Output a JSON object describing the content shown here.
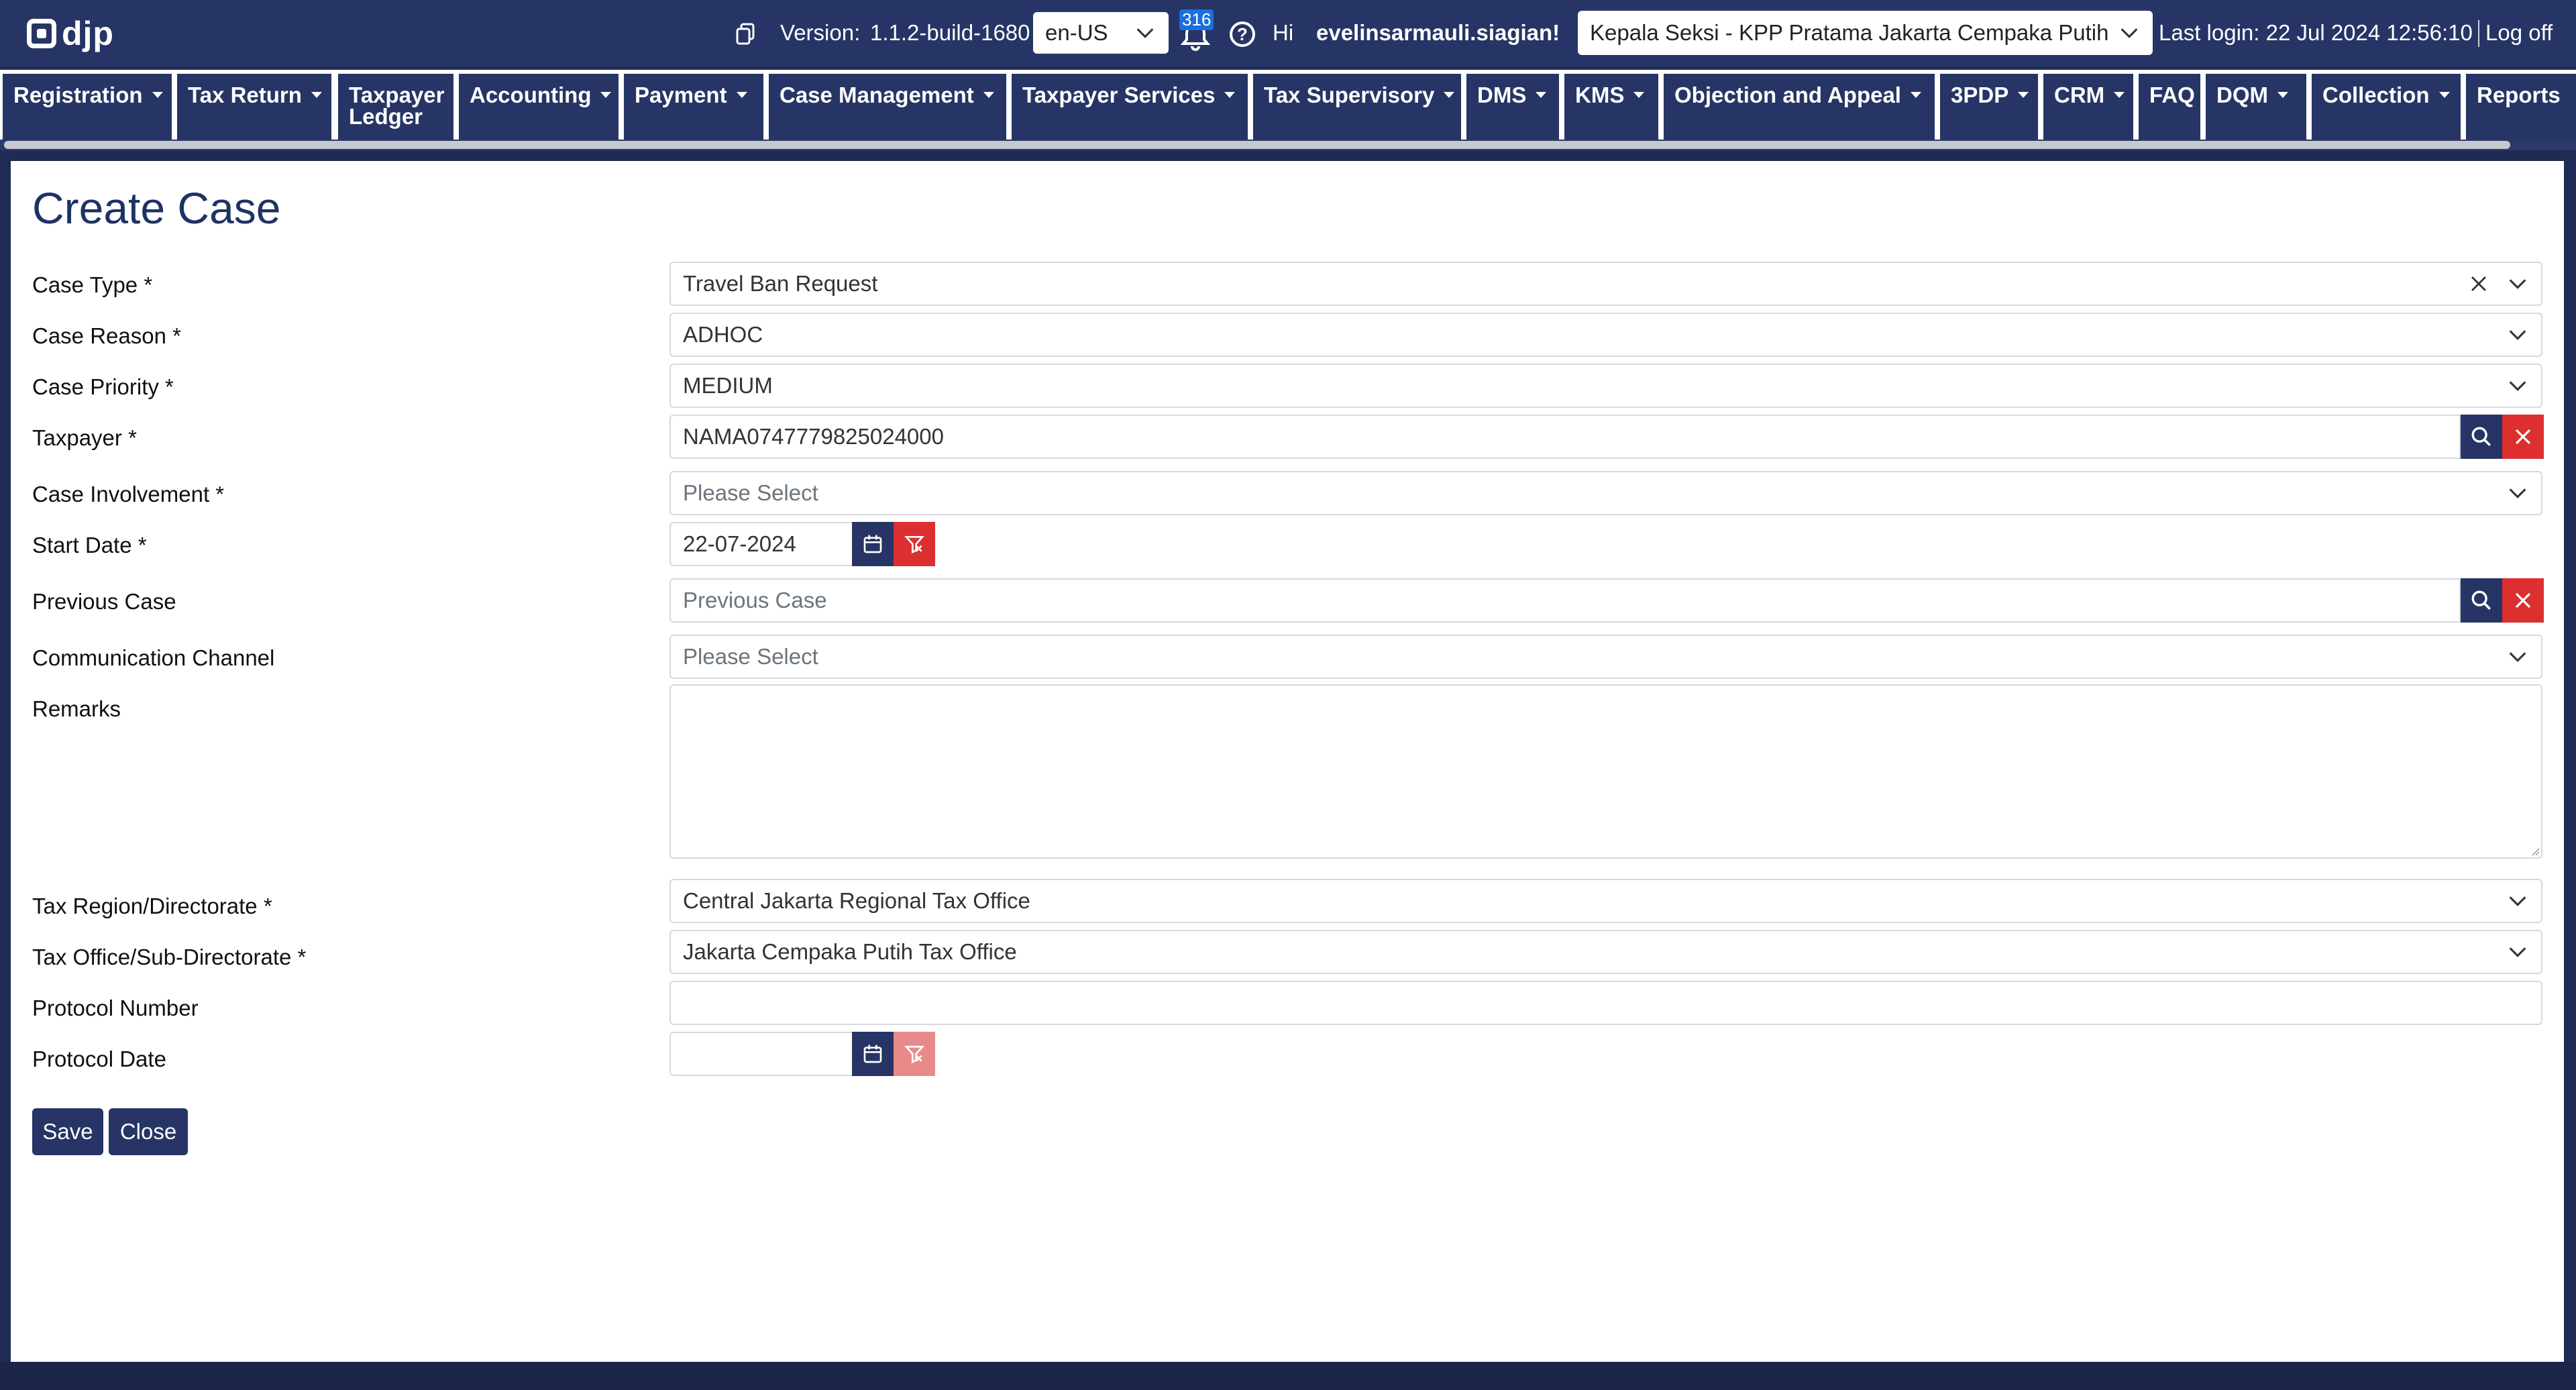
{
  "header": {
    "logo_text": "djp",
    "version_label": "Version:",
    "version_value": "1.1.2-build-1680",
    "language": "en-US",
    "notification_count": "316",
    "greeting": "Hi",
    "username": "evelinsarmauli.siagian!",
    "role": "Kepala Seksi - KPP Pratama Jakarta Cempaka Putih",
    "last_login": "Last login: 22 Jul 2024 12:56:10",
    "logoff": "Log off"
  },
  "nav": {
    "items": [
      {
        "label": "Registration"
      },
      {
        "label": "Tax Return"
      },
      {
        "label": "Taxpayer",
        "label2": "Ledger"
      },
      {
        "label": "Accounting"
      },
      {
        "label": "Payment"
      },
      {
        "label": "Case Management"
      },
      {
        "label": "Taxpayer Services"
      },
      {
        "label": "Tax Supervisory"
      },
      {
        "label": "DMS"
      },
      {
        "label": "KMS"
      },
      {
        "label": "Objection and Appeal"
      },
      {
        "label": "3PDP"
      },
      {
        "label": "CRM"
      },
      {
        "label": "FAQ"
      },
      {
        "label": "DQM"
      },
      {
        "label": "Collection"
      },
      {
        "label": "Reports"
      }
    ]
  },
  "form": {
    "title": "Create Case",
    "case_type": {
      "label": "Case Type *",
      "value": "Travel Ban Request"
    },
    "case_reason": {
      "label": "Case Reason *",
      "value": "ADHOC"
    },
    "case_priority": {
      "label": "Case Priority *",
      "value": "MEDIUM"
    },
    "taxpayer": {
      "label": "Taxpayer *",
      "value": "NAMA0747779825024000"
    },
    "case_involvement": {
      "label": "Case Involvement *",
      "placeholder": "Please Select"
    },
    "start_date": {
      "label": "Start Date *",
      "value": "22-07-2024"
    },
    "previous_case": {
      "label": "Previous Case",
      "placeholder": "Previous Case"
    },
    "communication_channel": {
      "label": "Communication Channel",
      "placeholder": "Please Select"
    },
    "remarks": {
      "label": "Remarks",
      "value": ""
    },
    "tax_region": {
      "label": "Tax Region/Directorate *",
      "value": "Central Jakarta Regional Tax Office"
    },
    "tax_office": {
      "label": "Tax Office/Sub-Directorate *",
      "value": "Jakarta Cempaka Putih Tax Office"
    },
    "protocol_number": {
      "label": "Protocol Number",
      "value": ""
    },
    "protocol_date": {
      "label": "Protocol Date",
      "value": ""
    },
    "save_label": "Save",
    "close_label": "Close"
  },
  "colors": {
    "primary": "#263565",
    "danger": "#dc2f2f",
    "danger_disabled": "#e88a8a",
    "title": "#1e3264"
  }
}
